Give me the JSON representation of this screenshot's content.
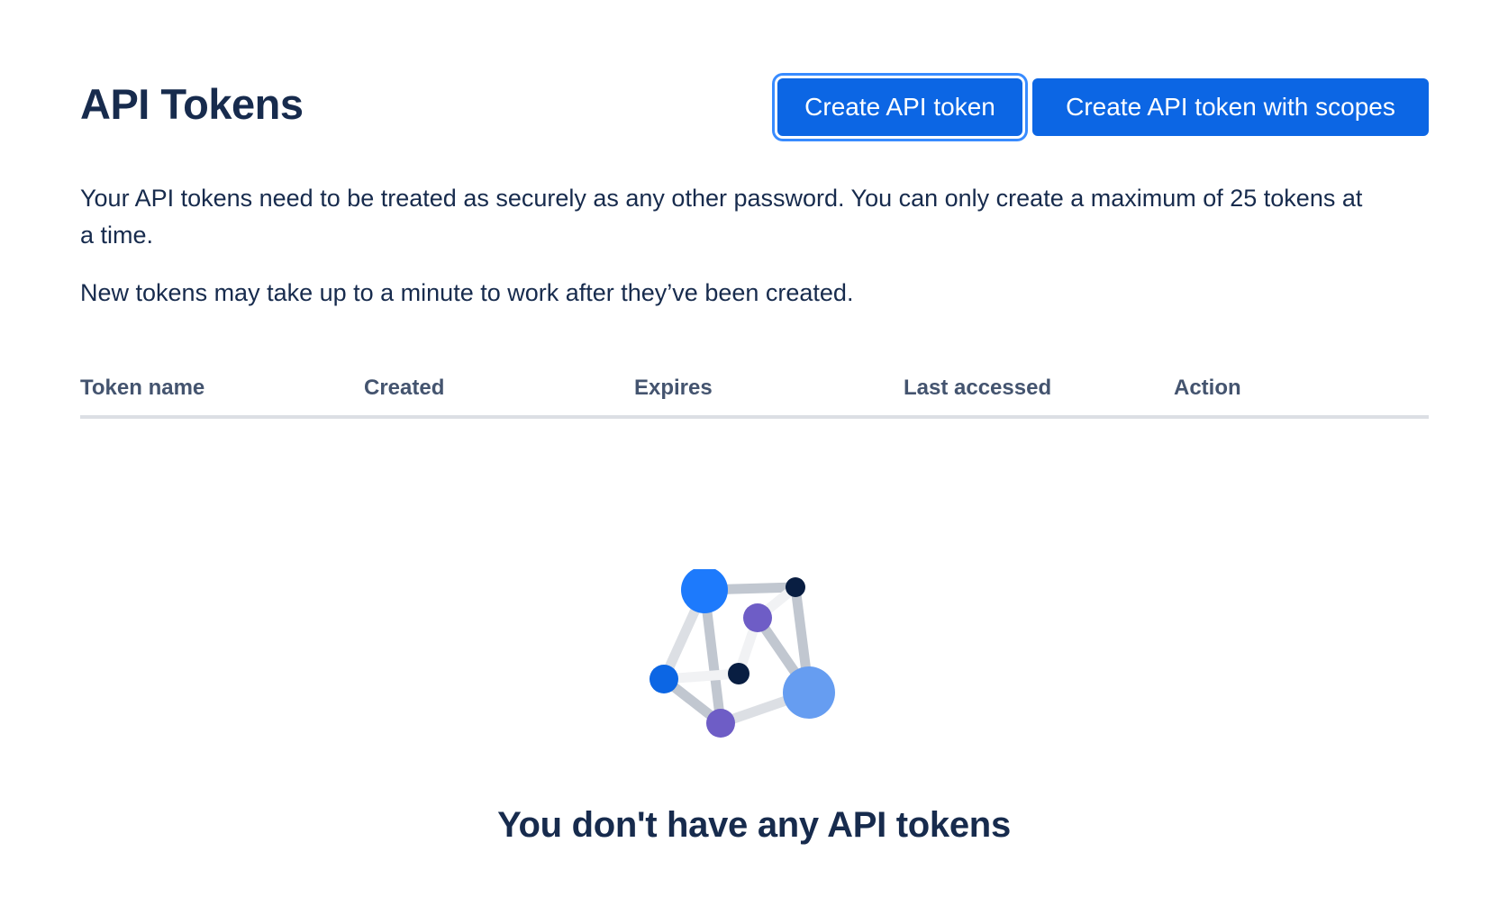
{
  "header": {
    "title": "API Tokens",
    "create_button_label": "Create API token",
    "create_scoped_button_label": "Create API token with scopes"
  },
  "description": {
    "paragraph_1": "Your API tokens need to be treated as securely as any other password. You can only create a maximum of 25 tokens at a time.",
    "paragraph_2": "New tokens may take up to a minute to work after they’ve been created."
  },
  "table": {
    "columns": [
      "Token name",
      "Created",
      "Expires",
      "Last accessed",
      "Action"
    ],
    "rows": []
  },
  "empty_state": {
    "illustration": "network-nodes-illustration",
    "message": "You don't have any API tokens"
  },
  "colors": {
    "primary_button": "#0c66e4",
    "focus_ring": "#388bff",
    "text_primary": "#172b4d",
    "text_subtle": "#44546f",
    "divider": "#dcdfe4",
    "node_blue": "#1d7afc",
    "node_light_blue": "#669df1",
    "node_purple": "#6e5dc6",
    "node_navy": "#091e42",
    "edge_gray": "#c1c7d0"
  }
}
